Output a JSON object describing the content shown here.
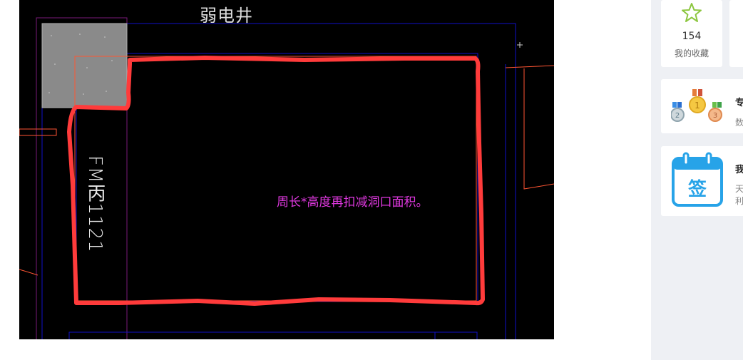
{
  "cad": {
    "wall_label": "弱电井",
    "door_label": "FM丙1121",
    "note": "周长*高度再扣减洞口面积。"
  },
  "sidebar": {
    "favorites": {
      "count": "154",
      "label": "我的收藏"
    },
    "ranking": {
      "title": "专",
      "desc": "数"
    },
    "checkin": {
      "title": "我",
      "desc_line1": "天",
      "desc_line2": "利",
      "icon_text": "签"
    }
  },
  "colors": {
    "outline_red": "#ff3b3b",
    "cad_blue": "#1010c8",
    "note_magenta": "#e038e0",
    "star_green": "#8cc63f",
    "calendar_blue": "#27a3e8"
  }
}
